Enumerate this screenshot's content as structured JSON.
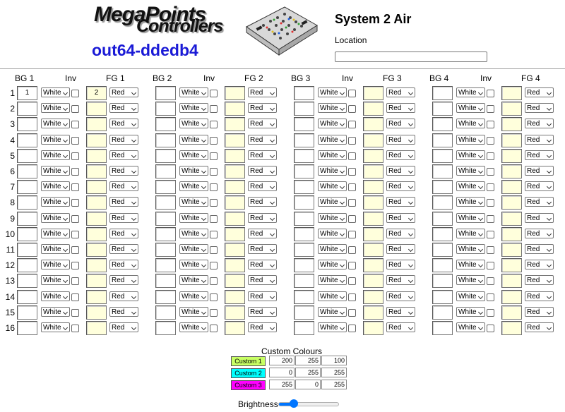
{
  "logo": {
    "line1": "MegaPoints",
    "line2": "Controllers"
  },
  "device_name": "out64-ddedb4",
  "system_title": "System 2 Air",
  "location": {
    "label": "Location",
    "value": ""
  },
  "columns": [
    {
      "bg": "BG 1",
      "inv": "Inv",
      "fg": "FG 1"
    },
    {
      "bg": "BG 2",
      "inv": "Inv",
      "fg": "FG 2"
    },
    {
      "bg": "BG 3",
      "inv": "Inv",
      "fg": "FG 3"
    },
    {
      "bg": "BG 4",
      "inv": "Inv",
      "fg": "FG 4"
    }
  ],
  "rows": [
    "1",
    "2",
    "3",
    "4",
    "5",
    "6",
    "7",
    "8",
    "9",
    "10",
    "11",
    "12",
    "13",
    "14",
    "15",
    "16"
  ],
  "defaults": {
    "bg_select": "White",
    "fg_select": "Red"
  },
  "prefilled": {
    "row1_bg1": "1",
    "row1_fg1": "2"
  },
  "custom": {
    "title": "Custom Colours",
    "items": [
      {
        "label": "Custom 1",
        "color": "#c8ff64",
        "r": "200",
        "g": "255",
        "b": "100"
      },
      {
        "label": "Custom 2",
        "color": "#00ffff",
        "r": "0",
        "g": "255",
        "b": "255"
      },
      {
        "label": "Custom 3",
        "color": "#ff00ff",
        "r": "255",
        "g": "0",
        "b": "255"
      }
    ]
  },
  "brightness": {
    "label": "Brightness",
    "level": 0.25
  }
}
